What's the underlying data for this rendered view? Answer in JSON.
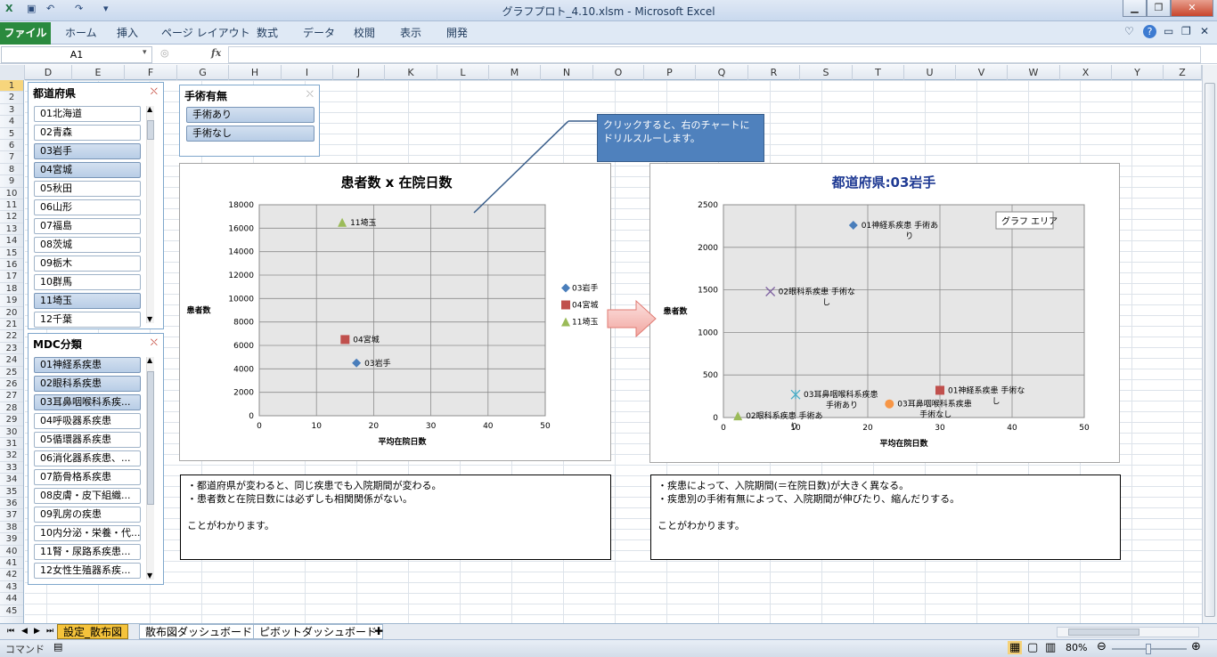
{
  "window": {
    "title": "グラフプロト_4.10.xlsm  -  Microsoft Excel"
  },
  "ribbon": {
    "file": "ファイル",
    "tabs": [
      "ホーム",
      "挿入",
      "ページ レイアウト",
      "数式",
      "データ",
      "校閲",
      "表示",
      "開発"
    ]
  },
  "formula": {
    "cell": "A1",
    "fx": "fx"
  },
  "columns": [
    "D",
    "E",
    "F",
    "G",
    "H",
    "I",
    "J",
    "K",
    "L",
    "M",
    "N",
    "O",
    "P",
    "Q",
    "R",
    "S",
    "T",
    "U",
    "V",
    "W",
    "X",
    "Y",
    "Z"
  ],
  "rows": [
    "1",
    "2",
    "3",
    "4",
    "5",
    "6",
    "7",
    "8",
    "9",
    "10",
    "11",
    "12",
    "13",
    "14",
    "15",
    "16",
    "17",
    "18",
    "19",
    "20",
    "21",
    "22",
    "23",
    "24",
    "25",
    "26",
    "27",
    "28",
    "29",
    "30",
    "31",
    "32",
    "33",
    "34",
    "35",
    "36",
    "37",
    "38",
    "39",
    "40",
    "41",
    "42",
    "43",
    "44",
    "45"
  ],
  "slicer_pref": {
    "header": "都道府県",
    "items": [
      {
        "label": "01北海道",
        "selected": false
      },
      {
        "label": "02青森",
        "selected": false
      },
      {
        "label": "03岩手",
        "selected": true
      },
      {
        "label": "04宮城",
        "selected": true
      },
      {
        "label": "05秋田",
        "selected": false
      },
      {
        "label": "06山形",
        "selected": false
      },
      {
        "label": "07福島",
        "selected": false
      },
      {
        "label": "08茨城",
        "selected": false
      },
      {
        "label": "09栃木",
        "selected": false
      },
      {
        "label": "10群馬",
        "selected": false
      },
      {
        "label": "11埼玉",
        "selected": true
      },
      {
        "label": "12千葉",
        "selected": false
      }
    ]
  },
  "slicer_mdc": {
    "header": "MDC分類",
    "items": [
      {
        "label": "01神経系疾患",
        "selected": true
      },
      {
        "label": "02眼科系疾患",
        "selected": true
      },
      {
        "label": "03耳鼻咽喉科系疾...",
        "selected": true
      },
      {
        "label": "04呼吸器系疾患",
        "selected": false
      },
      {
        "label": "05循環器系疾患",
        "selected": false
      },
      {
        "label": "06消化器系疾患、...",
        "selected": false
      },
      {
        "label": "07筋骨格系疾患",
        "selected": false
      },
      {
        "label": "08皮膚・皮下組織...",
        "selected": false
      },
      {
        "label": "09乳房の疾患",
        "selected": false
      },
      {
        "label": "10内分泌・栄養・代...",
        "selected": false
      },
      {
        "label": "11腎・尿路系疾患...",
        "selected": false
      },
      {
        "label": "12女性生殖器系疾...",
        "selected": false
      }
    ]
  },
  "slicer_surgery": {
    "header": "手術有無",
    "items": [
      {
        "label": "手術あり",
        "selected": true
      },
      {
        "label": "手術なし",
        "selected": true
      }
    ]
  },
  "callout": {
    "text": "クリックすると、右のチャートにドリルスルーします。"
  },
  "chart_data": [
    {
      "type": "scatter",
      "title": "患者数 x 在院日数",
      "xlabel": "平均在院日数",
      "ylabel": "患者数",
      "xlim": [
        0,
        50
      ],
      "ylim": [
        0,
        18000
      ],
      "xticks": [
        0,
        10,
        20,
        30,
        40,
        50
      ],
      "yticks": [
        0,
        2000,
        4000,
        6000,
        8000,
        10000,
        12000,
        14000,
        16000,
        18000
      ],
      "legend": "right",
      "series": [
        {
          "name": "03岩手",
          "color": "#4a7ebb",
          "marker": "diamond",
          "points": [
            {
              "x": 17,
              "y": 4500,
              "label": "03岩手"
            }
          ]
        },
        {
          "name": "04宮城",
          "color": "#c0504d",
          "marker": "square",
          "points": [
            {
              "x": 15,
              "y": 6500,
              "label": "04宮城"
            }
          ]
        },
        {
          "name": "11埼玉",
          "color": "#9bbb59",
          "marker": "triangle",
          "points": [
            {
              "x": 14.5,
              "y": 16500,
              "label": "11埼玉"
            }
          ]
        }
      ]
    },
    {
      "type": "scatter",
      "title": "都道府県:03岩手",
      "xlabel": "平均在院日数",
      "ylabel": "患者数",
      "xlim": [
        0,
        50
      ],
      "ylim": [
        0,
        2500
      ],
      "xticks": [
        0,
        10,
        20,
        30,
        40,
        50
      ],
      "yticks": [
        0,
        500,
        1000,
        1500,
        2000,
        2500
      ],
      "tooltip": "グラフ エリア",
      "series": [
        {
          "color": "#4a7ebb",
          "marker": "diamond",
          "points": [
            {
              "x": 18,
              "y": 2260,
              "label": [
                "01神経系疾患 手術あ",
                "り"
              ]
            }
          ]
        },
        {
          "color": "#8064a2",
          "marker": "x",
          "points": [
            {
              "x": 6.5,
              "y": 1480,
              "label": [
                "02眼科系疾患 手術な",
                "し"
              ]
            }
          ]
        },
        {
          "color": "#4bacc6",
          "marker": "star",
          "points": [
            {
              "x": 10,
              "y": 270,
              "label": [
                "03耳鼻咽喉科系疾患",
                "手術あり"
              ]
            }
          ]
        },
        {
          "color": "#c0504d",
          "marker": "square",
          "points": [
            {
              "x": 30,
              "y": 320,
              "label": [
                "01神経系疾患 手術な",
                "し"
              ]
            }
          ]
        },
        {
          "color": "#f79646",
          "marker": "circle",
          "points": [
            {
              "x": 23,
              "y": 160,
              "label": [
                "03耳鼻咽喉科系疾患",
                "手術なし"
              ]
            }
          ]
        },
        {
          "color": "#9bbb59",
          "marker": "triangle",
          "points": [
            {
              "x": 2,
              "y": 20,
              "label": [
                "02眼科系疾患 手術あ",
                "り"
              ]
            }
          ]
        }
      ]
    }
  ],
  "note_left": {
    "lines": [
      "・都道府県が変わると、同じ疾患でも入院期間が変わる。",
      "・患者数と在院日数には必ずしも相関関係がない。",
      "",
      "ことがわかります。"
    ]
  },
  "note_right": {
    "lines": [
      "・疾患によって、入院期間(＝在院日数)が大きく異なる。",
      "・疾患別の手術有無によって、入院期間が伸びたり、縮んだりする。",
      "",
      "ことがわかります。"
    ]
  },
  "sheets": {
    "tabs": [
      "設定_散布図",
      "散布図ダッシュボード",
      "ピボットダッシュボード"
    ],
    "active": 0
  },
  "status": {
    "mode": "コマンド",
    "zoom": "80%"
  }
}
